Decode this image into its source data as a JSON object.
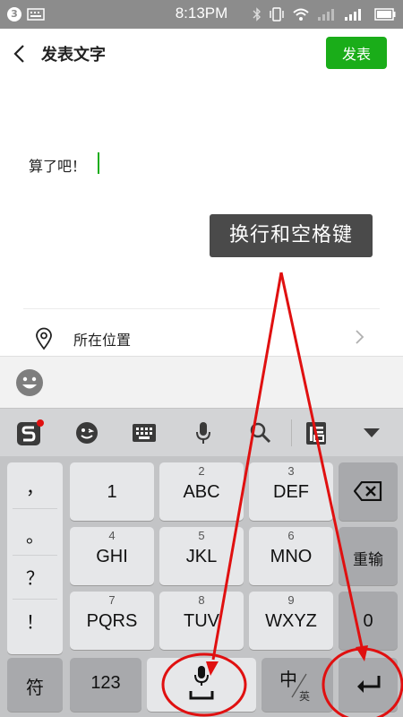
{
  "status_bar": {
    "notification_count": "3",
    "time": "8:13PM"
  },
  "header": {
    "title": "发表文字",
    "publish_label": "发表"
  },
  "compose": {
    "text": "算了吧！"
  },
  "annotation": {
    "tooltip": "换行和空格键",
    "color": "#e01010"
  },
  "location": {
    "label": "所在位置"
  },
  "keyboard": {
    "punctuation": [
      "，",
      "。",
      "？",
      "！"
    ],
    "keys": [
      {
        "num": "",
        "label": "1"
      },
      {
        "num": "2",
        "label": "ABC"
      },
      {
        "num": "3",
        "label": "DEF"
      },
      {
        "num": "4",
        "label": "GHI"
      },
      {
        "num": "5",
        "label": "JKL"
      },
      {
        "num": "6",
        "label": "MNO"
      },
      {
        "num": "7",
        "label": "PQRS"
      },
      {
        "num": "8",
        "label": "TUV"
      },
      {
        "num": "9",
        "label": "WXYZ"
      }
    ],
    "reinput_label": "重输",
    "zero_label": "0",
    "symbol_label": "符",
    "numeric_label": "123",
    "lang_primary": "中",
    "lang_secondary": "英",
    "toolbar_icons": [
      "sogou-logo-icon",
      "emoji-face-icon",
      "keyboard-icon",
      "microphone-icon",
      "search-icon",
      "clipboard-icon",
      "collapse-triangle-icon"
    ],
    "accent_color": "#1aad19"
  }
}
